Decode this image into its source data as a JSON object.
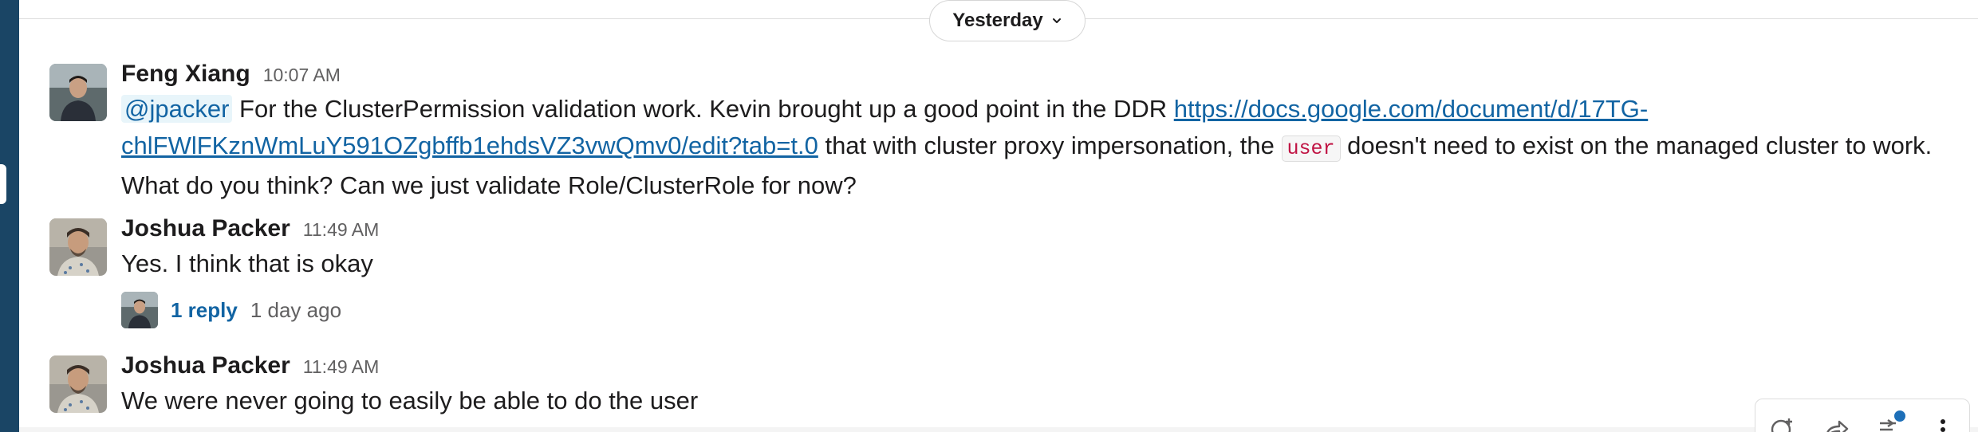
{
  "date_divider": {
    "label": "Yesterday"
  },
  "messages": [
    {
      "author": "Feng Xiang",
      "time": "10:07 AM",
      "mention": "@jpacker",
      "text_before_link": " For the ClusterPermission validation work. Kevin brought up a good point in the DDR ",
      "link": "https://docs.google.com/document/d/17TG-chlFWlFKznWmLuY591OZgbffb1ehdsVZ3vwQmv0/edit?tab=t.0",
      "text_after_link": " that with cluster proxy impersonation, the ",
      "code": "user",
      "text_after_code": " doesn't need to exist on the managed cluster to work. What do you think? Can we just validate Role/ClusterRole for now?"
    },
    {
      "author": "Joshua Packer",
      "time": "11:49 AM",
      "text": "Yes. I think that is okay",
      "thread": {
        "reply_count": "1 reply",
        "last_reply": "1 day ago"
      }
    },
    {
      "author": "Joshua Packer",
      "time": "11:49 AM",
      "text": "We were never going to easily be able to do the user"
    }
  ],
  "icons": {
    "date_chevron": "chevron-down-icon",
    "actions": [
      "add-reaction-icon",
      "forward-icon",
      "reply-thread-icon",
      "more-actions-icon"
    ]
  },
  "colors": {
    "link": "#1264a3",
    "code_text": "#c01343",
    "sidebar": "#1a4565",
    "notification_dot": "#1d6fb8"
  }
}
